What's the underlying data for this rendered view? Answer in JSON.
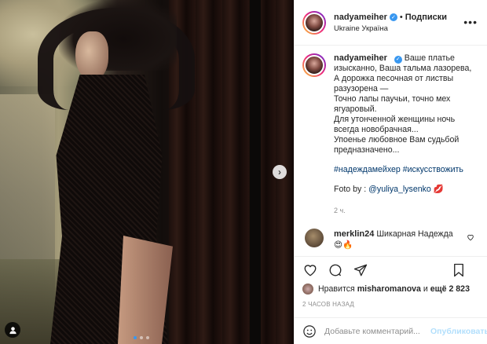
{
  "post": {
    "username": "nadyameiher",
    "follow_label": "Подписки",
    "separator": "•",
    "location": "Ukraine Україна",
    "more_icon": "more-dots-icon"
  },
  "caption": {
    "username": "nadyameiher",
    "first_line": "Ваше платье",
    "body": "изысканно, Ваша тальма лазорева,\nА дорожка песочная от листвы разузорена —\nТочно лапы паучьи, точно мех ягуаровый.\nДля утонченной женщины ночь всегда новобрачная...\nУпоенье любовное Вам судьбой предназначено...",
    "hashtags": "#надеждамейхер #искусствожить",
    "credit_prefix": "Foto by : ",
    "credit_handle": "@yuliya_lysenko",
    "credit_emoji": "💋",
    "age": "2 ч."
  },
  "comment": {
    "username": "merklin24",
    "text": "Шикарная Надежда",
    "emoji": "😍🔥"
  },
  "likes": {
    "prefix": "Нравится",
    "user": "misharomanova",
    "middle": "и",
    "others": "ещё 2 823"
  },
  "timestamp": "2 ЧАСОВ НАЗАД",
  "add_comment": {
    "placeholder": "Добавьте комментарий...",
    "publish_label": "Опубликовать"
  },
  "colors": {
    "accent_blue": "#3897f0",
    "link_blue": "#00376b",
    "muted": "#8e8e8e",
    "publish_disabled": "#b2dffc"
  }
}
